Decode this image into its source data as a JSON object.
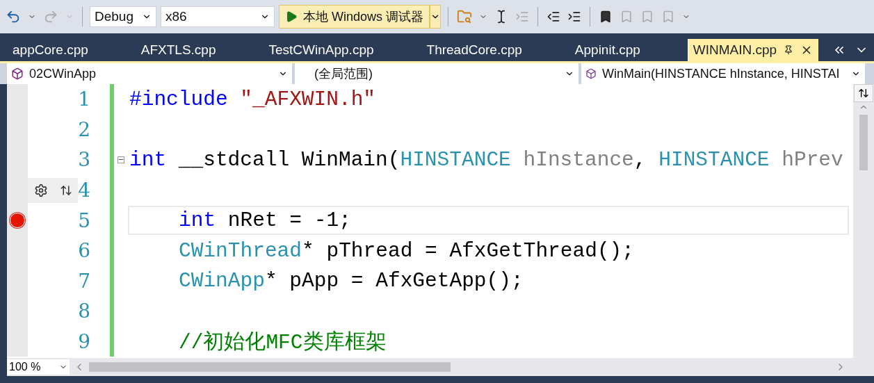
{
  "toolbar": {
    "config": "Debug",
    "platform": "x86",
    "run_label": "本地 Windows 调试器"
  },
  "tabs": [
    {
      "label": "appCore.cpp",
      "selected": false
    },
    {
      "label": "AFXTLS.cpp",
      "selected": false
    },
    {
      "label": "TestCWinApp.cpp",
      "selected": false
    },
    {
      "label": "ThreadCore.cpp",
      "selected": false
    },
    {
      "label": "Appinit.cpp",
      "selected": false
    },
    {
      "label": "WINMAIN.cpp",
      "selected": true
    }
  ],
  "nav": {
    "project": "02CWinApp",
    "scope": "(全局范围)",
    "member": "WinMain(HINSTANCE hInstance, HINSTAI"
  },
  "lines": [
    {
      "number": "1",
      "breakpoint": false,
      "fold": false,
      "current": false,
      "hover_tools": false,
      "indent": false,
      "tokens": [
        {
          "t": "#include",
          "kind": "preproc"
        },
        {
          "t": " \"_AFXWIN.h\"",
          "kind": "string"
        }
      ]
    },
    {
      "number": "2",
      "breakpoint": false,
      "fold": false,
      "current": false,
      "hover_tools": false,
      "indent": false
    },
    {
      "number": "3",
      "breakpoint": false,
      "fold": true,
      "current": false,
      "hover_tools": false,
      "indent": false,
      "tokens": [
        {
          "t": "int",
          "kind": "keyword"
        },
        {
          "t": " __stdcall WinMain(",
          "kind": "plain"
        },
        {
          "t": "HINSTANCE",
          "kind": "type"
        },
        {
          "t": " hInstance",
          "kind": "param"
        },
        {
          "t": ", ",
          "kind": "plain"
        },
        {
          "t": "HINSTANCE",
          "kind": "type"
        },
        {
          "t": " hPrev",
          "kind": "param"
        }
      ]
    },
    {
      "number": "4",
      "breakpoint": false,
      "fold": false,
      "current": false,
      "hover_tools": true,
      "indent": false
    },
    {
      "number": "5",
      "breakpoint": true,
      "fold": false,
      "current": true,
      "hover_tools": false,
      "indent": true,
      "tokens": [
        {
          "t": "int",
          "kind": "keyword"
        },
        {
          "t": " nRet = -1;",
          "kind": "plain"
        }
      ]
    },
    {
      "number": "6",
      "breakpoint": false,
      "fold": false,
      "current": false,
      "hover_tools": false,
      "indent": true,
      "tokens": [
        {
          "t": "CWinThread",
          "kind": "type"
        },
        {
          "t": "* pThread = AfxGetThread();",
          "kind": "plain"
        }
      ]
    },
    {
      "number": "7",
      "breakpoint": false,
      "fold": false,
      "current": false,
      "hover_tools": false,
      "indent": true,
      "tokens": [
        {
          "t": "CWinApp",
          "kind": "type"
        },
        {
          "t": "* pApp = AfxGetApp();",
          "kind": "plain"
        }
      ]
    },
    {
      "number": "8",
      "breakpoint": false,
      "fold": false,
      "current": false,
      "hover_tools": false,
      "indent": false
    },
    {
      "number": "9",
      "breakpoint": false,
      "fold": false,
      "current": false,
      "hover_tools": false,
      "indent": true,
      "tokens": [
        {
          "t": "//初始化MFC类库框架",
          "kind": "comment"
        }
      ]
    }
  ],
  "zoom": "100 %"
}
